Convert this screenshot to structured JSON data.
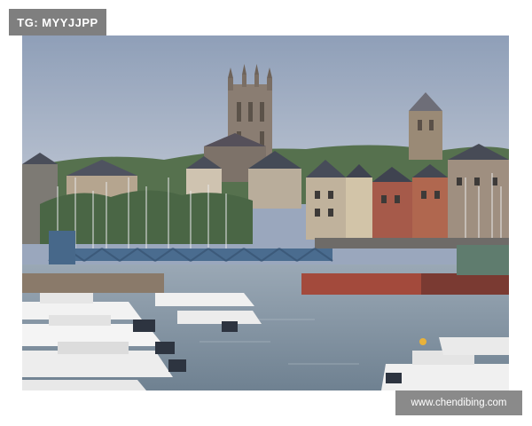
{
  "overlay": {
    "tag_label": "TG: MYYJJPP",
    "url_label": "www.chendibing.com"
  },
  "photo": {
    "subject_icons": [
      "cathedral-tower",
      "church-spire",
      "swing-bridge",
      "moored-boats",
      "harbor-water",
      "townhouses"
    ],
    "colors": {
      "sky": "#9ba9c0",
      "water": "#8a9aa9",
      "bridge": "#4a6c8f",
      "stone": "#8c7f73",
      "roofs": "#4a4e5a",
      "brick": "#a65a4a",
      "trees": "#3f5e3c",
      "boats": "#f2f2f2"
    }
  }
}
